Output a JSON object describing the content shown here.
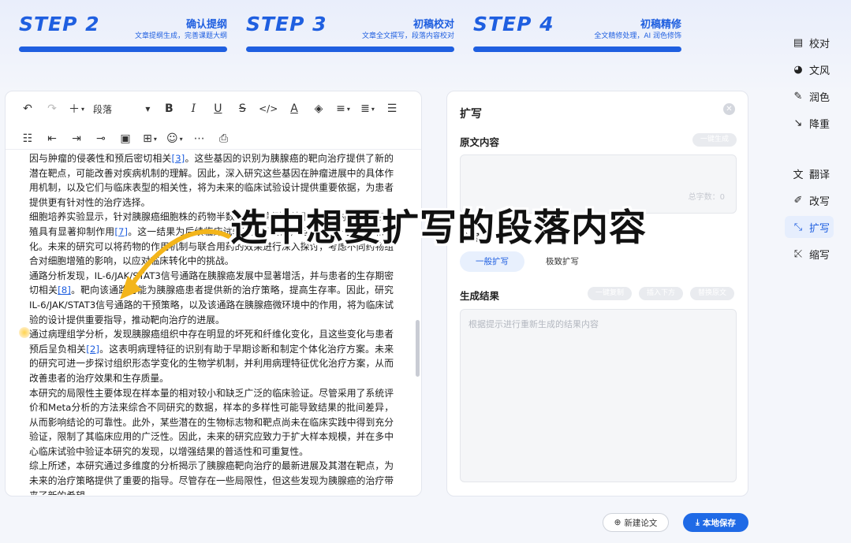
{
  "steps": [
    {
      "label": "STEP 2",
      "title": "确认提纲",
      "subtitle": "文章提纲生成，完善课题大纲"
    },
    {
      "label": "STEP 3",
      "title": "初稿校对",
      "subtitle": "文章全文撰写，段落内容校对"
    },
    {
      "label": "STEP 4",
      "title": "初稿精修",
      "subtitle": "全文精修处理，AI 润色修饰"
    }
  ],
  "toolbar": {
    "paragraph_select": "段落",
    "icons": [
      "undo-icon",
      "redo-icon",
      "insert-plus-icon",
      "bold-icon",
      "italic-icon",
      "underline-icon",
      "strikethrough-icon",
      "code-icon",
      "font-color-icon",
      "highlight-icon",
      "align-icon",
      "line-height-icon",
      "bullet-list-icon",
      "numbered-list-icon",
      "outdent-icon",
      "indent-icon",
      "link-icon",
      "image-icon",
      "table-icon",
      "emoji-icon",
      "more-icon",
      "export-icon"
    ]
  },
  "editor": {
    "paragraphs": [
      {
        "segments": [
          {
            "t": "因与肿瘤的侵袭性和预后密切相关"
          },
          {
            "t": "[3]",
            "ref": true
          },
          {
            "t": "。这些基因的识别为胰腺癌的靶向治疗提供了新的潜在靶点，可能改善对疾病机制的理解。因此，深入研究这些基因在肿瘤进展中的具体作用机制，以及它们与临床表型的相关性，将为未来的临床试验设计提供重要依据，为患者提供更有针对性的治疗选择。"
          }
        ]
      },
      {
        "segments": [
          {
            "t": "细胞培养实验显示，针对胰腺癌细胞株的药物半数抑制浓度测定结果表明，对肿瘤细胞增殖具有显著抑制作用"
          },
          {
            "t": "[7]",
            "ref": true
          },
          {
            "t": "。这一结果为后续临床试验奠定了基础，但仍需进一步开发和优化。未来的研究可以将药物的作用机制与联合用药的效果进行深入探讨，考虑不同药物组合对细胞增殖的影响，以应对临床转化中的挑战。"
          }
        ]
      },
      {
        "segments": [
          {
            "t": "通路分析发现，IL-6/JAK/STAT3信号通路在胰腺癌发展中显著增活，并与患者的生存期密切相关"
          },
          {
            "t": "[8]",
            "ref": true
          },
          {
            "t": "。靶向该通路可能为胰腺癌患者提供新的治疗策略，提高生存率。因此，研究IL-6/JAK/STAT3信号通路的干预策略，以及该通路在胰腺癌微环境中的作用，将为临床试验的设计提供重要指导，推动靶向治疗的进展。"
          }
        ]
      },
      {
        "segments": [
          {
            "t": "通过病理组学分析，发现胰腺癌组织中存在明显的坏死和纤维化变化，且这些变化与患者预后呈负相关"
          },
          {
            "t": "[2]",
            "ref": true
          },
          {
            "t": "。这表明病理特征的识别有助于早期诊断和制定个体化治疗方案。未来的研究可进一步探讨组织形态学变化的生物学机制，并利用病理特征优化治疗方案，从而改善患者的治疗效果和生存质量。"
          }
        ]
      },
      {
        "segments": [
          {
            "t": "本研究的局限性主要体现在样本量的相对较小和缺乏广泛的临床验证。尽管采用了系统评价和Meta分析的方法来综合不同研究的数据，样本的多样性可能导致结果的批间差异，从而影响结论的可靠性。此外，某些潜在的生物标志物和靶点尚未在临床实践中得到充分验证，限制了其临床应用的广泛性。因此，未来的研究应致力于扩大样本规模，并在多中心临床试验中验证本研究的发现，以增强结果的普适性和可重复性。"
          }
        ]
      },
      {
        "segments": [
          {
            "t": "综上所述，本研究通过多维度的分析揭示了胰腺癌靶向治疗的最新进展及其潜在靶点，为未来的治疗策略提供了重要的指导。尽管存在一些局限性，但这些发现为胰腺癌的治疗带来了新的希望。"
          }
        ]
      }
    ]
  },
  "panel": {
    "title": "扩写",
    "original_label": "原文内容",
    "generate_button": "一键生成",
    "word_count": "总字数：0",
    "mode_label": "扩写",
    "modes": [
      "一般扩写",
      "极致扩写"
    ],
    "result_label": "生成结果",
    "copy_button": "一键复制",
    "insert_button": "插入下方",
    "replace_button": "替换原文",
    "result_placeholder": "根据提示进行重新生成的结果内容"
  },
  "sidebar": {
    "items": [
      {
        "label": "校对",
        "icon": "proofread-icon",
        "glyph": "▤"
      },
      {
        "label": "文风",
        "icon": "palette-icon",
        "glyph": "◕"
      },
      {
        "label": "润色",
        "icon": "polish-wand-icon",
        "glyph": "✎"
      },
      {
        "label": "降重",
        "icon": "reduce-chart-icon",
        "glyph": "↘"
      },
      {
        "label": "翻译",
        "icon": "translate-icon",
        "glyph": "文"
      },
      {
        "label": "改写",
        "icon": "rewrite-icon",
        "glyph": "✐"
      },
      {
        "label": "扩写",
        "icon": "expand-icon",
        "glyph": "⤡",
        "active": true
      },
      {
        "label": "缩写",
        "icon": "shrink-icon",
        "glyph": "⤪"
      }
    ]
  },
  "footer": {
    "new_paper": "新建论文",
    "save_local": "本地保存"
  },
  "overlay": {
    "caption": "选中想要扩写的段落内容"
  },
  "colors": {
    "accent": "#1f5fe0",
    "annotation_arrow": "#f3b51b"
  }
}
